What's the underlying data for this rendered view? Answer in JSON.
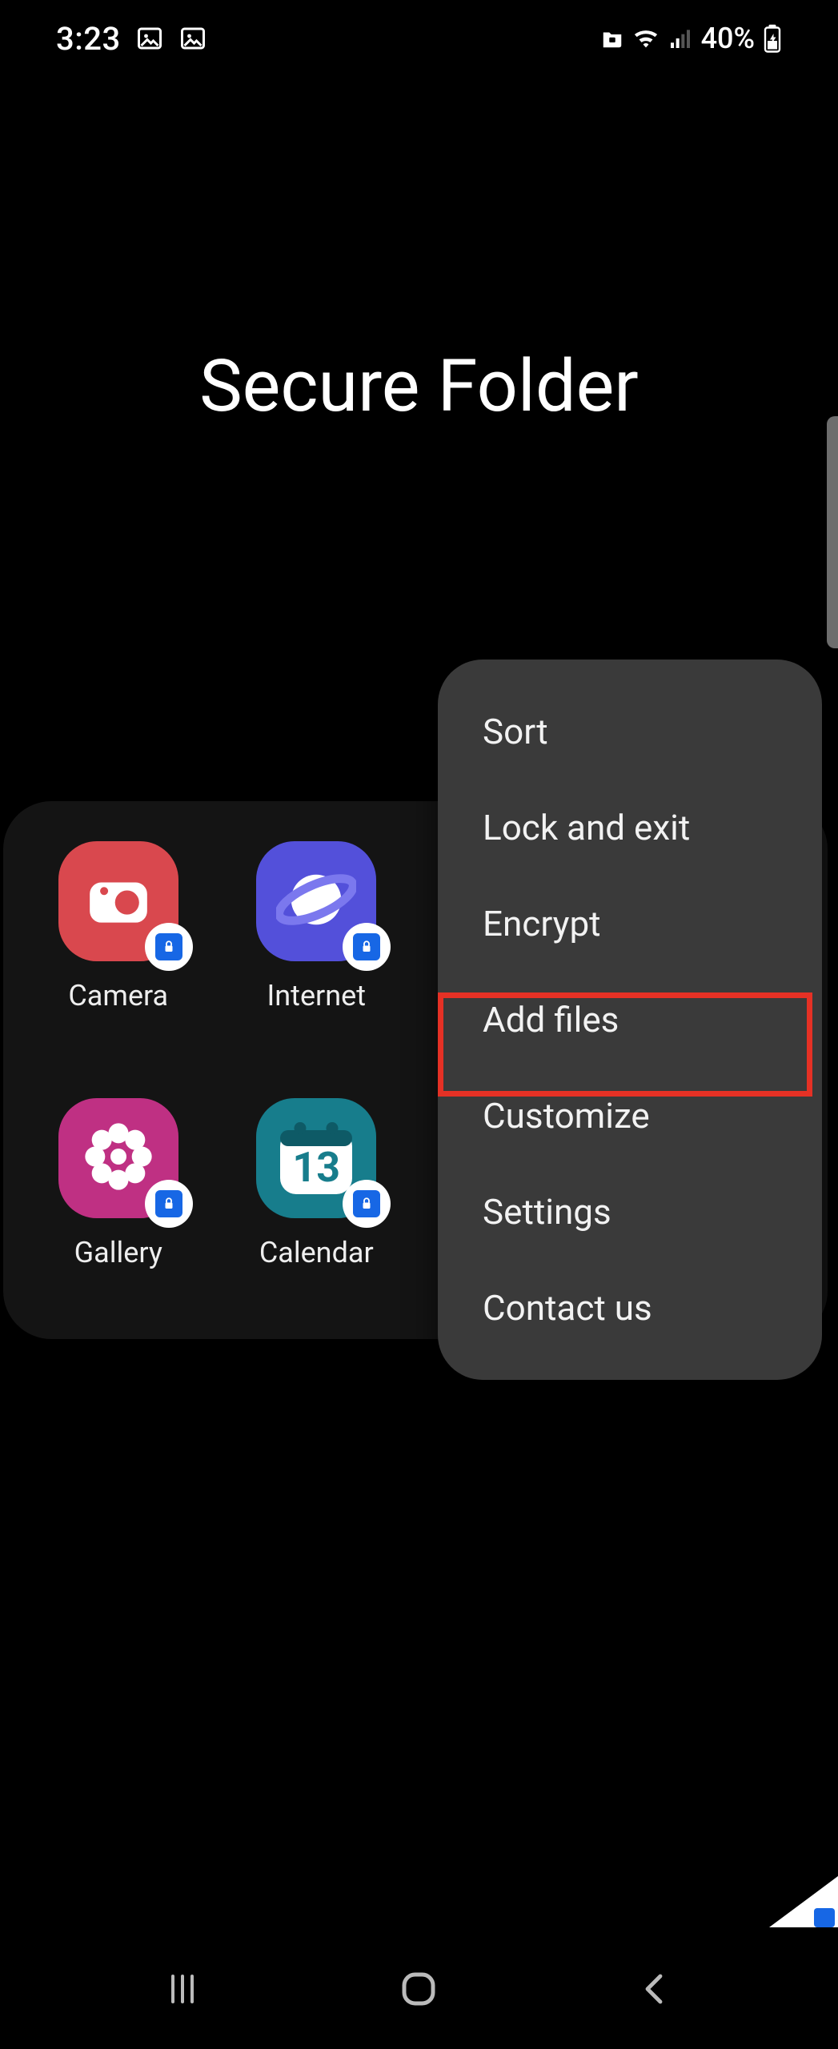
{
  "status_bar": {
    "time": "3:23",
    "battery_text": "40%"
  },
  "title": "Secure Folder",
  "apps": [
    {
      "label": "Camera",
      "bg": "#d9484e",
      "icon": "camera"
    },
    {
      "label": "Internet",
      "bg": "#5350da",
      "icon": "planet"
    },
    {
      "label": "Gallery",
      "bg": "#bf3083",
      "icon": "flower"
    },
    {
      "label": "Calendar",
      "bg": "#177d8c",
      "icon": "calendar",
      "cal_day": "13"
    }
  ],
  "menu": {
    "items": [
      "Sort",
      "Lock and exit",
      "Encrypt",
      "Add files",
      "Customize",
      "Settings",
      "Contact us"
    ]
  }
}
